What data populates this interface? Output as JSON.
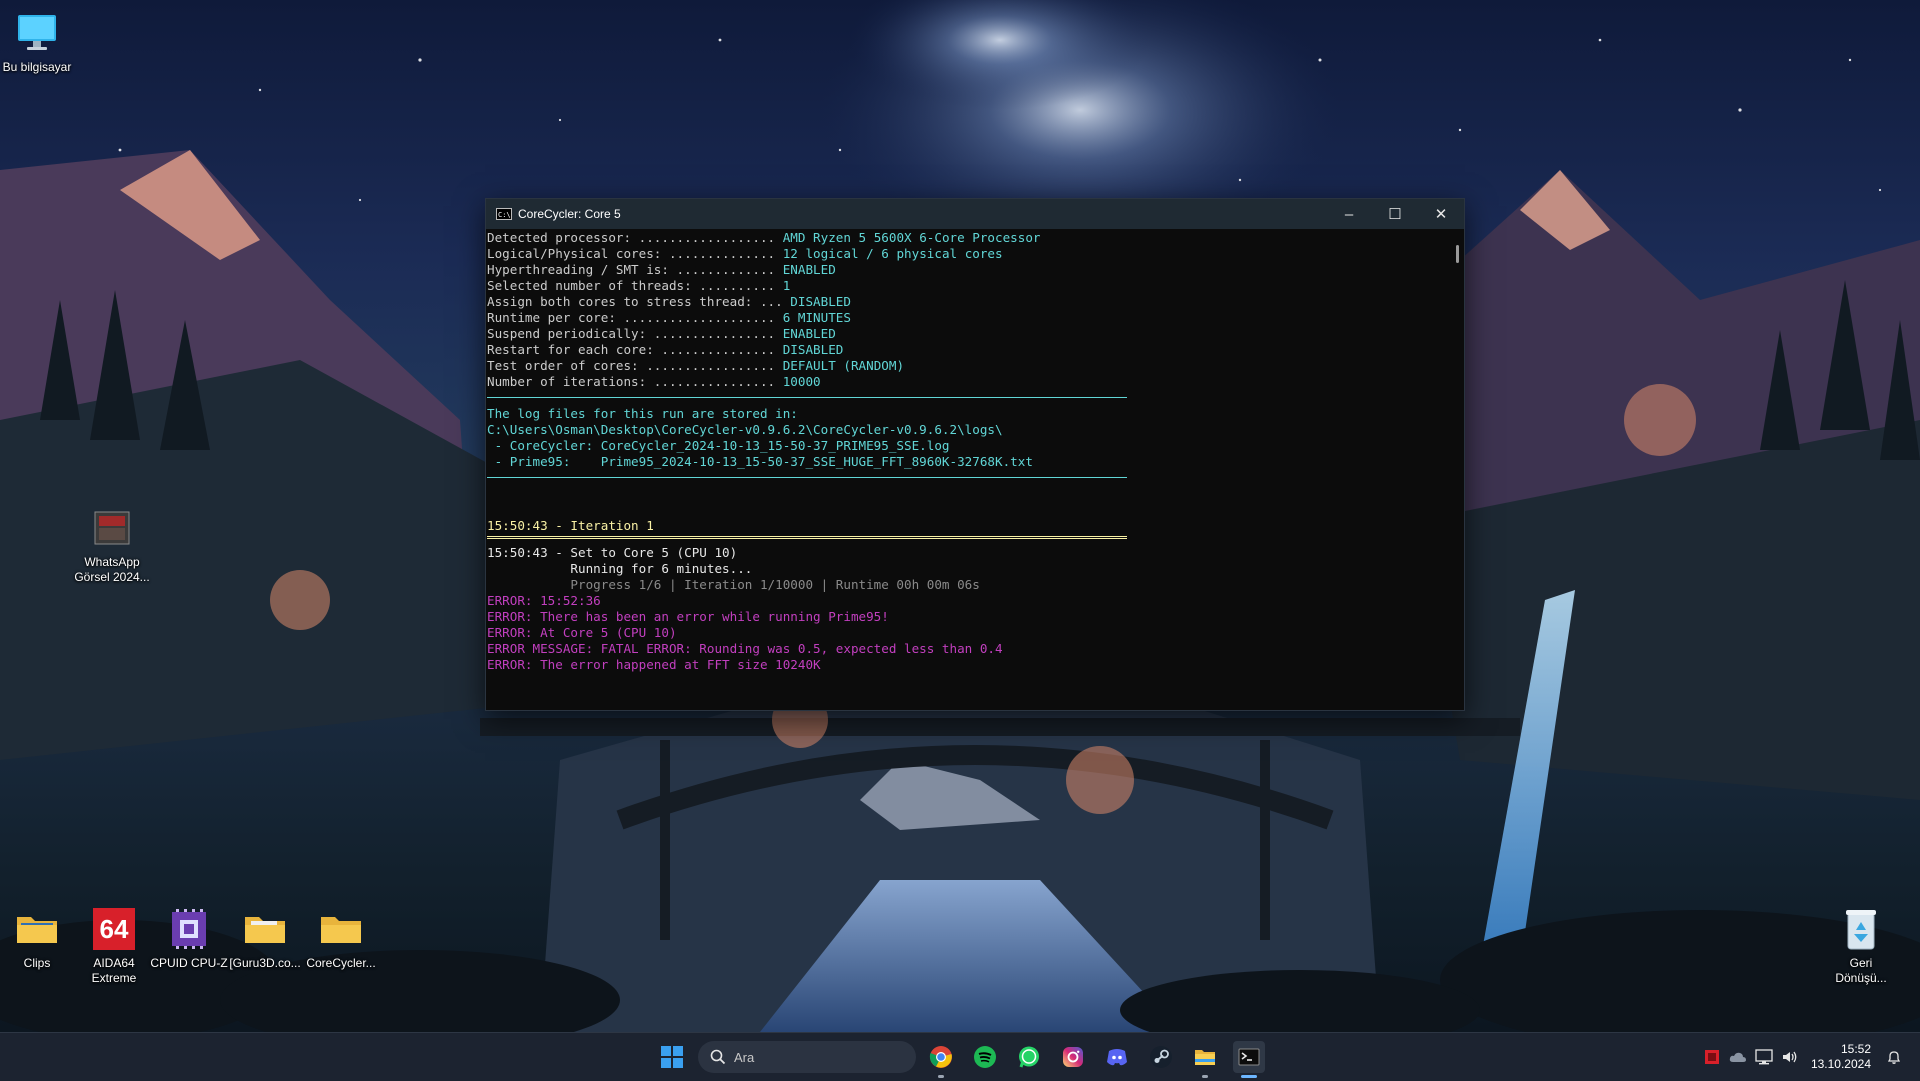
{
  "desktop": {
    "icons": [
      {
        "label": "Bu bilgisayar"
      },
      {
        "label": "WhatsApp\nGörsel 2024..."
      },
      {
        "label": "Clips"
      },
      {
        "label": "AIDA64\nExtreme"
      },
      {
        "label": "CPUID CPU-Z"
      },
      {
        "label": "[Guru3D.co..."
      },
      {
        "label": "CoreCycler..."
      },
      {
        "label": "Geri\nDönüşü..."
      }
    ],
    "aida_badge": "64"
  },
  "window": {
    "title": "CoreCycler: Core 5",
    "buttons": {
      "minimize": "–",
      "maximize": "☐",
      "close": "✕"
    }
  },
  "console": {
    "info": [
      {
        "key": "Detected processor: ..................",
        "value": "AMD Ryzen 5 5600X 6-Core Processor"
      },
      {
        "key": "Logical/Physical cores: ..............",
        "value": "12 logical / 6 physical cores"
      },
      {
        "key": "Hyperthreading / SMT is: .............",
        "value": "ENABLED"
      },
      {
        "key": "Selected number of threads: ..........",
        "value": "1"
      },
      {
        "key": "Assign both cores to stress thread: ...",
        "value": "DISABLED"
      },
      {
        "key": "Runtime per core: ....................",
        "value": "6 MINUTES"
      },
      {
        "key": "Suspend periodically: ................",
        "value": "ENABLED"
      },
      {
        "key": "Restart for each core: ...............",
        "value": "DISABLED"
      },
      {
        "key": "Test order of cores: .................",
        "value": "DEFAULT (RANDOM)"
      },
      {
        "key": "Number of iterations: ................",
        "value": "10000"
      }
    ],
    "log_header": "The log files for this run are stored in:",
    "log_path": "C:\\Users\\Osman\\Desktop\\CoreCycler-v0.9.6.2\\CoreCycler-v0.9.6.2\\logs\\",
    "log_corecycler": " - CoreCycler: CoreCycler_2024-10-13_15-50-37_PRIME95_SSE.log",
    "log_prime95": " - Prime95:    Prime95_2024-10-13_15-50-37_SSE_HUGE_FFT_8960K-32768K.txt",
    "iteration_line": "15:50:43 - Iteration 1",
    "set_core_line": "15:50:43 - Set to Core 5 (CPU 10)",
    "running_line": "           Running for 6 minutes...",
    "progress_line": "           Progress 1/6 | Iteration 1/10000 | Runtime 00h 00m 06s",
    "errors": [
      "ERROR: 15:52:36",
      "ERROR: There has been an error while running Prime95!",
      "ERROR: At Core 5 (CPU 10)",
      "ERROR MESSAGE: FATAL ERROR: Rounding was 0.5, expected less than 0.4",
      "ERROR: The error happened at FFT size 10240K"
    ]
  },
  "taskbar": {
    "search_placeholder": "Ara",
    "apps": [
      "start-icon",
      "chrome-icon",
      "spotify-icon",
      "whatsapp-icon",
      "instagram-icon",
      "discord-icon",
      "steam-icon",
      "file-explorer-icon",
      "terminal-icon"
    ],
    "clock_time": "15:52",
    "clock_date": "13.10.2024"
  },
  "colors": {
    "console_bg": "#0c0c0c",
    "console_text": "#cccccc",
    "console_cyan": "#61d6d6",
    "console_yellow": "#f9f1a5",
    "console_error": "#c23fbf",
    "taskbar_bg": "#1c2330"
  }
}
